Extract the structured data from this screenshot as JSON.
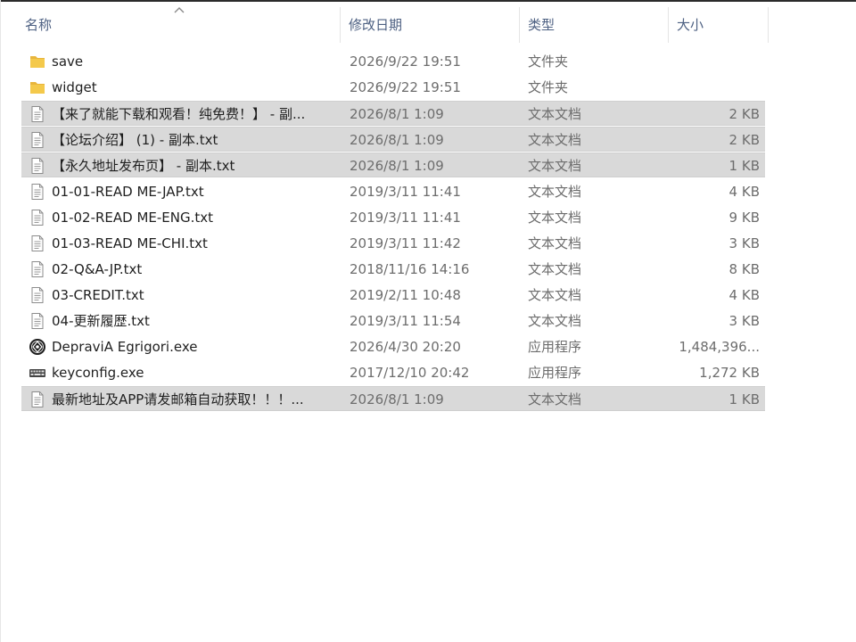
{
  "columns": {
    "name": "名称",
    "date": "修改日期",
    "type": "类型",
    "size": "大小"
  },
  "sort": {
    "column": "name",
    "direction": "ascending",
    "icon": "sort-ascending-arrow-icon"
  },
  "colors": {
    "header_text": "#4d6082",
    "selected_row": "#d9d9d9",
    "folder_icon": "#f4c94b"
  },
  "files": [
    {
      "name": "save",
      "date": "2026/9/22 19:51",
      "type": "文件夹",
      "size": "",
      "icon": "folder-icon",
      "selected": false
    },
    {
      "name": "widget",
      "date": "2026/9/22 19:51",
      "type": "文件夹",
      "size": "",
      "icon": "folder-icon",
      "selected": false
    },
    {
      "name": "【来了就能下载和观看！纯免费！】 - 副...",
      "date": "2026/8/1 1:09",
      "type": "文本文档",
      "size": "2 KB",
      "icon": "text-file-icon",
      "selected": true
    },
    {
      "name": "【论坛介绍】 (1) - 副本.txt",
      "date": "2026/8/1 1:09",
      "type": "文本文档",
      "size": "2 KB",
      "icon": "text-file-icon",
      "selected": true
    },
    {
      "name": "【永久地址发布页】 - 副本.txt",
      "date": "2026/8/1 1:09",
      "type": "文本文档",
      "size": "1 KB",
      "icon": "text-file-icon",
      "selected": true
    },
    {
      "name": "01-01-READ ME-JAP.txt",
      "date": "2019/3/11 11:41",
      "type": "文本文档",
      "size": "4 KB",
      "icon": "text-file-icon",
      "selected": false
    },
    {
      "name": "01-02-READ ME-ENG.txt",
      "date": "2019/3/11 11:41",
      "type": "文本文档",
      "size": "9 KB",
      "icon": "text-file-icon",
      "selected": false
    },
    {
      "name": "01-03-READ ME-CHI.txt",
      "date": "2019/3/11 11:42",
      "type": "文本文档",
      "size": "3 KB",
      "icon": "text-file-icon",
      "selected": false
    },
    {
      "name": "02-Q&A-JP.txt",
      "date": "2018/11/16 14:16",
      "type": "文本文档",
      "size": "8 KB",
      "icon": "text-file-icon",
      "selected": false
    },
    {
      "name": "03-CREDIT.txt",
      "date": "2019/2/11 10:48",
      "type": "文本文档",
      "size": "4 KB",
      "icon": "text-file-icon",
      "selected": false
    },
    {
      "name": "04-更新履歴.txt",
      "date": "2019/3/11 11:54",
      "type": "文本文档",
      "size": "3 KB",
      "icon": "text-file-icon",
      "selected": false
    },
    {
      "name": "DepraviA Egrigori.exe",
      "date": "2026/4/30 20:20",
      "type": "应用程序",
      "size": "1,484,396...",
      "icon": "game-app-icon",
      "selected": false
    },
    {
      "name": "keyconfig.exe",
      "date": "2017/12/10 20:42",
      "type": "应用程序",
      "size": "1,272 KB",
      "icon": "keyboard-app-icon",
      "selected": false
    },
    {
      "name": "最新地址及APP请发邮箱自动获取！！！...",
      "date": "2026/8/1 1:09",
      "type": "文本文档",
      "size": "1 KB",
      "icon": "text-file-icon",
      "selected": true
    }
  ]
}
